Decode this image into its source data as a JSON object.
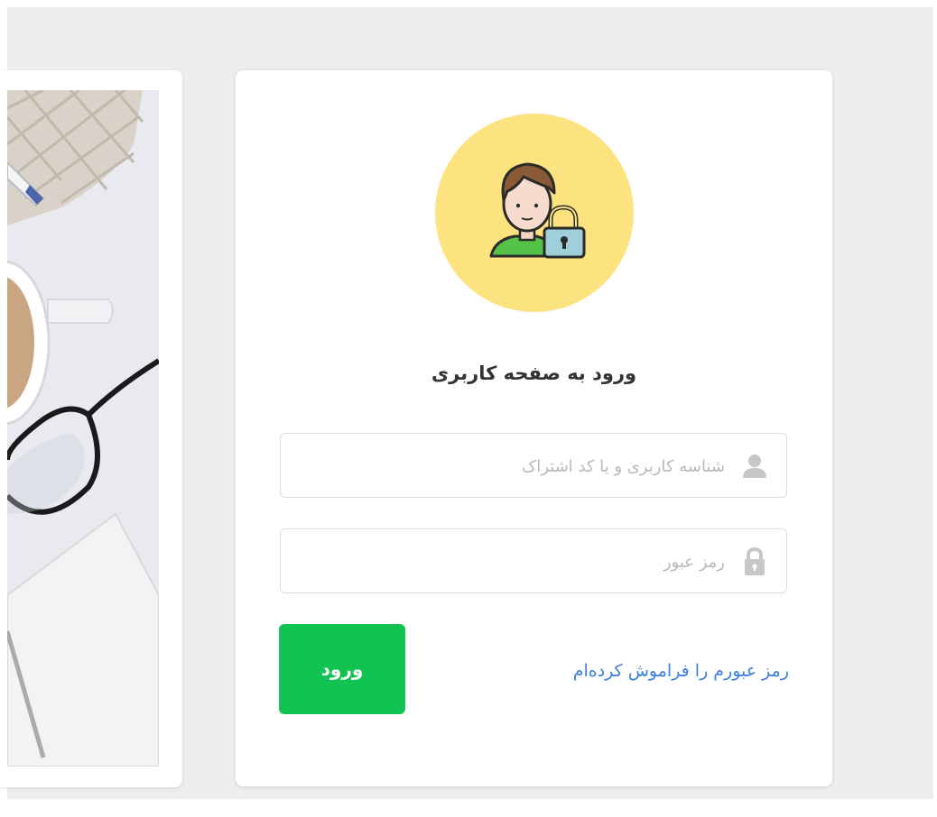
{
  "colors": {
    "page_background": "#eeeeee",
    "avatar_circle": "#fde37f",
    "submit_button": "#13c351",
    "link": "#3d7fe0"
  },
  "login": {
    "title": "ورود به صفحه کاربری",
    "username_placeholder": "شناسه کاربری و یا کد اشتراک",
    "username_icon": "user-icon",
    "password_placeholder": "رمز عبور",
    "password_icon": "lock-icon",
    "submit_label": "ورود",
    "forgot_link": "رمز عبورم را فراموش کرده‌ام"
  },
  "side_image": {
    "description": "desk-photo"
  }
}
